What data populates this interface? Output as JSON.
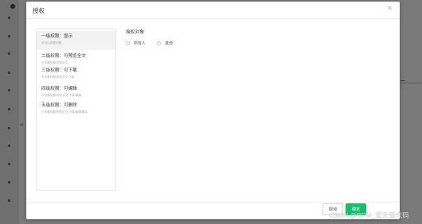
{
  "modal": {
    "title": "授权",
    "close_icon": "close-icon",
    "permission_levels": [
      {
        "title": "一级权限：显示",
        "desc": "仅可以查看标题"
      },
      {
        "title": "二级权限：可预览全文",
        "desc": "可查看标题/预览全文"
      },
      {
        "title": "三级权限：可下载",
        "desc": "可查看标题/预览全文/下载"
      },
      {
        "title": "四级权限：可编辑",
        "desc": "可查看标题/预览全文/下载/编辑"
      },
      {
        "title": "五级权限：可删除",
        "desc": "可查看标题/预览全文/下载/编辑/删除"
      }
    ],
    "active_index": 0,
    "target": {
      "label": "授权对象",
      "options": [
        "所有人",
        "其他"
      ]
    },
    "buttons": {
      "cancel": "取消",
      "ok": "确定"
    }
  },
  "watermark": "CSDN @BPM_宏天低代码",
  "colors": {
    "primary": "#19be6b",
    "overlay": "#7a7a7a"
  }
}
